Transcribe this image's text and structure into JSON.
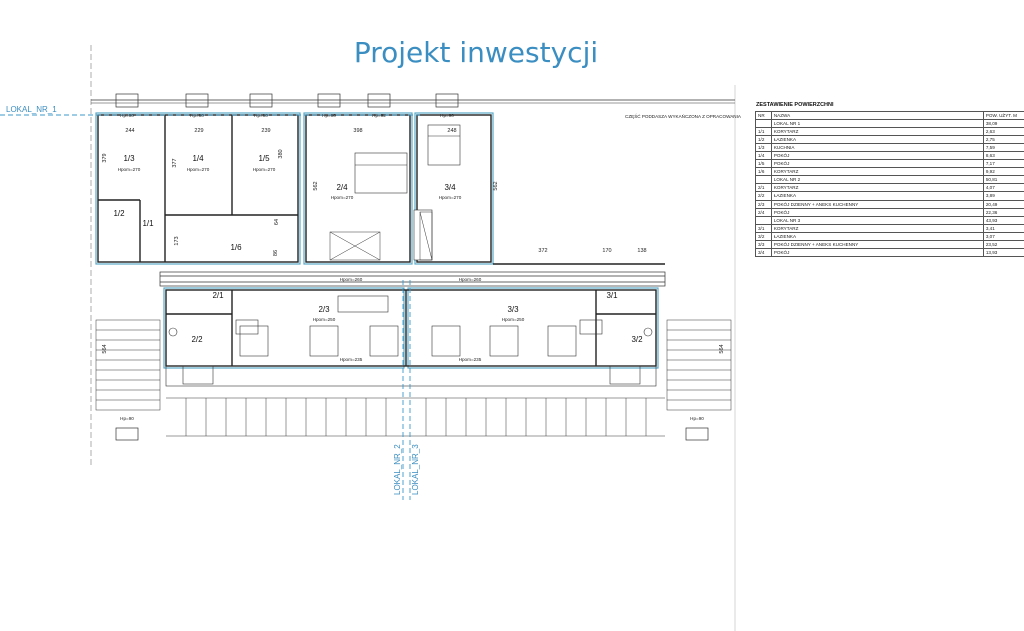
{
  "title": "Projekt inwestycji",
  "plan_note": "CZĘŚĆ PODDASZA WYKAŃCZONA Z OPRACOWANIA",
  "unit_labels": {
    "lokal1": "LOKAL_NR_1",
    "lokal2": "LOKAL_NR_2",
    "lokal3": "LOKAL_NR_3"
  },
  "room_tags": [
    "1/1",
    "1/2",
    "1/3",
    "1/4",
    "1/5",
    "1/6",
    "2/1",
    "2/2",
    "2/3",
    "2/4",
    "3/1",
    "3/2",
    "3/3",
    "3/4"
  ],
  "room_heights": {
    "h270": "Hpom=270",
    "h250": "Hpom=250",
    "h260": "Hpom=260",
    "h235": "Hpom=235",
    "hp90": "Hp=90",
    "hp92": "Hp=92"
  },
  "dimensions": [
    "244",
    "229",
    "239",
    "398",
    "248",
    "372",
    "170",
    "138",
    "379",
    "377",
    "380",
    "562",
    "562",
    "562",
    "173",
    "86",
    "64",
    "564",
    "564"
  ],
  "area_table": {
    "title": "ZESTAWIENIE POWIERZCHNI",
    "columns": [
      "NR",
      "NAZWA",
      "POW. UŻYT. M"
    ],
    "rows": [
      {
        "nr": "",
        "name": "LOKAL NR 1",
        "area": "38,09"
      },
      {
        "nr": "1/1",
        "name": "KORYTARZ",
        "area": "2,63"
      },
      {
        "nr": "1/2",
        "name": "ŁAZIENKA",
        "area": "2,75"
      },
      {
        "nr": "1/3",
        "name": "KUCHNIA",
        "area": "7,59"
      },
      {
        "nr": "1/4",
        "name": "POKÓJ",
        "area": "8,63"
      },
      {
        "nr": "1/5",
        "name": "POKÓJ",
        "area": "7,17"
      },
      {
        "nr": "1/6",
        "name": "KORYTARZ",
        "area": "9,92"
      },
      {
        "nr": "",
        "name": "LOKAL NR 2",
        "area": "50,81"
      },
      {
        "nr": "2/1",
        "name": "KORYTARZ",
        "area": "4,07"
      },
      {
        "nr": "2/2",
        "name": "ŁAZIENKA",
        "area": "3,89"
      },
      {
        "nr": "2/3",
        "name": "POKÓJ DZIENNY + ANEKS KUCHENNY",
        "area": "20,49"
      },
      {
        "nr": "2/4",
        "name": "POKÓJ",
        "area": "22,36"
      },
      {
        "nr": "",
        "name": "LOKAL NR 3",
        "area": "43,93"
      },
      {
        "nr": "3/1",
        "name": "KORYTARZ",
        "area": "3,41"
      },
      {
        "nr": "3/2",
        "name": "ŁAZIENKA",
        "area": "3,07"
      },
      {
        "nr": "3/3",
        "name": "POKÓJ DZIENNY + ANEKS KUCHENNY",
        "area": "23,52"
      },
      {
        "nr": "3/4",
        "name": "POKÓJ",
        "area": "13,93"
      }
    ]
  },
  "colors": {
    "title": "#3b8ec1",
    "walls": "#222222",
    "unit_outline": "#5aa9c9"
  }
}
